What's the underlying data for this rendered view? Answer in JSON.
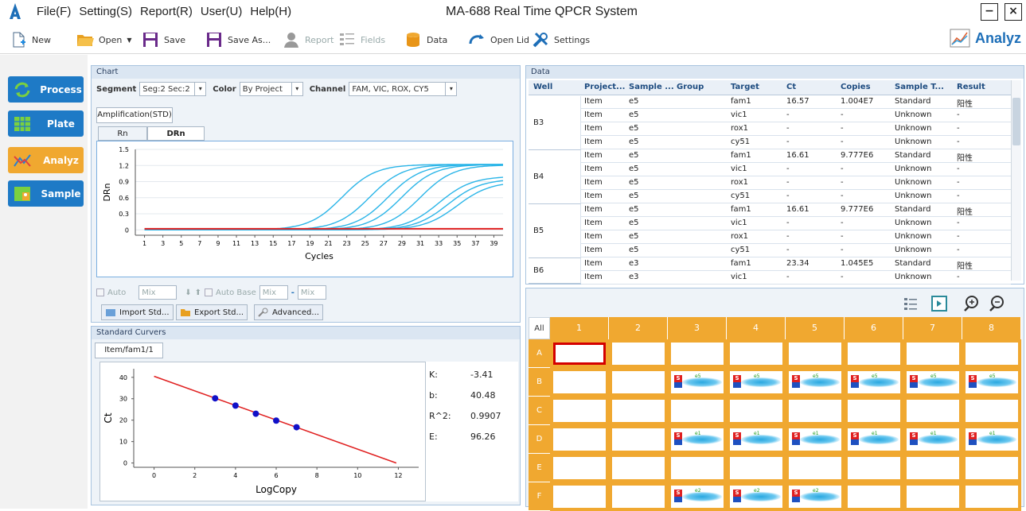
{
  "menu": [
    "File(F)",
    "Setting(S)",
    "Report(R)",
    "User(U)",
    "Help(H)"
  ],
  "app_title": "MA-688 Real Time QPCR System",
  "window_buttons": {
    "minimize": "−",
    "close": "×"
  },
  "toolbar": {
    "new": "New",
    "open": "Open",
    "save": "Save",
    "save_as": "Save As...",
    "report": "Report",
    "fields": "Fields",
    "data": "Data",
    "open_lid": "Open Lid",
    "settings": "Settings",
    "analyz": "Analyz"
  },
  "nav": [
    "Process",
    "Plate",
    "Analyz",
    "Sample"
  ],
  "chart_panel": {
    "header": "Chart",
    "segment_label": "Segment",
    "segment_value": "Seg:2 Sec:2",
    "color_label": "Color",
    "color_value": "By Project",
    "channel_label": "Channel",
    "channel_value": "FAM, VIC, ROX, CY5",
    "outer_tab": "Amplification(STD)",
    "tabs": [
      "Rn",
      "DRn"
    ],
    "controls": {
      "auto": "Auto",
      "mix1": "Mix",
      "auto_base": "Auto Base",
      "mix2": "Mix",
      "mix3": "Mix",
      "dash": "-"
    },
    "buttons": [
      "Import Std...",
      "Export Std...",
      "Advanced..."
    ]
  },
  "chart_data": [
    {
      "type": "line",
      "xlabel": "Cycles",
      "ylabel": "DRn",
      "xlim": [
        0,
        40
      ],
      "ylim": [
        -0.1,
        1.5
      ],
      "x_ticks": [
        1,
        3,
        5,
        7,
        9,
        11,
        13,
        15,
        17,
        19,
        21,
        23,
        25,
        27,
        29,
        31,
        33,
        35,
        37,
        39
      ],
      "y_ticks": [
        "1.5",
        "1.2",
        "0.9",
        "0.6",
        "0.3",
        "0"
      ],
      "series": [
        {
          "midpoint": 22.5,
          "plateau": 1.22
        },
        {
          "midpoint": 25.5,
          "plateau": 1.22
        },
        {
          "midpoint": 27.5,
          "plateau": 1.22
        },
        {
          "midpoint": 29.0,
          "plateau": 1.22
        },
        {
          "midpoint": 31.0,
          "plateau": 1.21
        },
        {
          "midpoint": 33.0,
          "plateau": 1.0
        },
        {
          "midpoint": 34.0,
          "plateau": 0.95
        },
        {
          "midpoint": 35.0,
          "plateau": 0.9
        }
      ],
      "threshold": 0.02,
      "colors": {
        "curves": "#2bb5e8",
        "threshold": "#e02020"
      }
    },
    {
      "type": "scatter",
      "xlabel": "LogCopy",
      "ylabel": "Ct",
      "xlim": [
        -1,
        13
      ],
      "ylim": [
        -2,
        44
      ],
      "x_ticks": [
        "0",
        "2",
        "4",
        "6",
        "8",
        "10",
        "12"
      ],
      "y_ticks": [
        "40",
        "30",
        "20",
        "10",
        "0"
      ],
      "points": [
        [
          3,
          30.2
        ],
        [
          4,
          26.8
        ],
        [
          5,
          23.0
        ],
        [
          6,
          19.8
        ],
        [
          7,
          16.7
        ]
      ],
      "fit": {
        "x": [
          0,
          11.9
        ],
        "y": [
          40.48,
          0
        ]
      },
      "colors": {
        "points": "#1010c8",
        "line": "#e02020"
      }
    }
  ],
  "std_panel": {
    "header": "Standard Curvers",
    "tab": "Item/fam1/1",
    "stats": [
      {
        "k": "K:",
        "v": "-3.41"
      },
      {
        "k": "b:",
        "v": "40.48"
      },
      {
        "k": "R^2:",
        "v": "0.9907"
      },
      {
        "k": "E:",
        "v": "96.26"
      }
    ]
  },
  "data_panel": {
    "header": "Data",
    "columns": [
      "Well",
      "Project...",
      "Sample ...",
      "Group",
      "Target",
      "Ct",
      "Copies",
      "Sample T...",
      "Result"
    ],
    "wells": [
      "B3",
      "B4",
      "B5",
      "B6"
    ],
    "rows": [
      [
        "Item",
        "e5",
        "",
        "fam1",
        "16.57",
        "1.004E7",
        "Standard",
        "阳性"
      ],
      [
        "Item",
        "e5",
        "",
        "vic1",
        "-",
        "-",
        "Unknown",
        "-"
      ],
      [
        "Item",
        "e5",
        "",
        "rox1",
        "-",
        "-",
        "Unknown",
        "-"
      ],
      [
        "Item",
        "e5",
        "",
        "cy51",
        "-",
        "-",
        "Unknown",
        "-"
      ],
      [
        "Item",
        "e5",
        "",
        "fam1",
        "16.61",
        "9.777E6",
        "Standard",
        "阳性"
      ],
      [
        "Item",
        "e5",
        "",
        "vic1",
        "-",
        "-",
        "Unknown",
        "-"
      ],
      [
        "Item",
        "e5",
        "",
        "rox1",
        "-",
        "-",
        "Unknown",
        "-"
      ],
      [
        "Item",
        "e5",
        "",
        "cy51",
        "-",
        "-",
        "Unknown",
        "-"
      ],
      [
        "Item",
        "e5",
        "",
        "fam1",
        "16.61",
        "9.777E6",
        "Standard",
        "阳性"
      ],
      [
        "Item",
        "e5",
        "",
        "vic1",
        "-",
        "-",
        "Unknown",
        "-"
      ],
      [
        "Item",
        "e5",
        "",
        "rox1",
        "-",
        "-",
        "Unknown",
        "-"
      ],
      [
        "Item",
        "e5",
        "",
        "cy51",
        "-",
        "-",
        "Unknown",
        "-"
      ],
      [
        "Item",
        "e3",
        "",
        "fam1",
        "23.34",
        "1.045E5",
        "Standard",
        "阳性"
      ],
      [
        "Item",
        "e3",
        "",
        "vic1",
        "-",
        "-",
        "Unknown",
        "-"
      ]
    ]
  },
  "plate": {
    "all_label": "All",
    "cols": [
      "1",
      "2",
      "3",
      "4",
      "5",
      "6",
      "7",
      "8"
    ],
    "rows": [
      "A",
      "B",
      "C",
      "D",
      "E",
      "F"
    ],
    "filled": {
      "B": {
        "3": "e5",
        "4": "e5",
        "5": "e5",
        "6": "e5",
        "7": "e5",
        "8": "e5"
      },
      "D": {
        "3": "e1",
        "4": "e1",
        "5": "e1",
        "6": "e1",
        "7": "e1",
        "8": "e1"
      },
      "F": {
        "3": "e2",
        "4": "e2",
        "5": "e2"
      }
    },
    "sample_badge": "S"
  }
}
